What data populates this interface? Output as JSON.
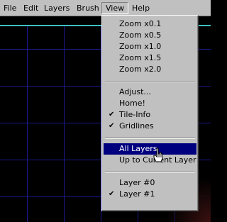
{
  "menubar": {
    "items": [
      "File",
      "Edit",
      "Layers",
      "Brush",
      "View",
      "Help"
    ]
  },
  "view_menu": {
    "zoom": [
      "Zoom x0.1",
      "Zoom x0.5",
      "Zoom x1.0",
      "Zoom x1.5",
      "Zoom x2.0"
    ],
    "adjust": "Adjust...",
    "home": "Home!",
    "tile_info": "Tile-Info",
    "gridlines": "Gridlines",
    "all_layers": "All Layers",
    "up_to_current": "Up to Current Layer",
    "layer0": "Layer #0",
    "layer1": "Layer #1",
    "check_glyph": "✔",
    "checked": [
      "Tile-Info",
      "Gridlines",
      "Layer #1"
    ],
    "highlighted": "All Layers"
  },
  "colors": {
    "grid": "#1a1a8c",
    "highlight": "#00007f",
    "menu_bg": "#c0c0c0"
  }
}
